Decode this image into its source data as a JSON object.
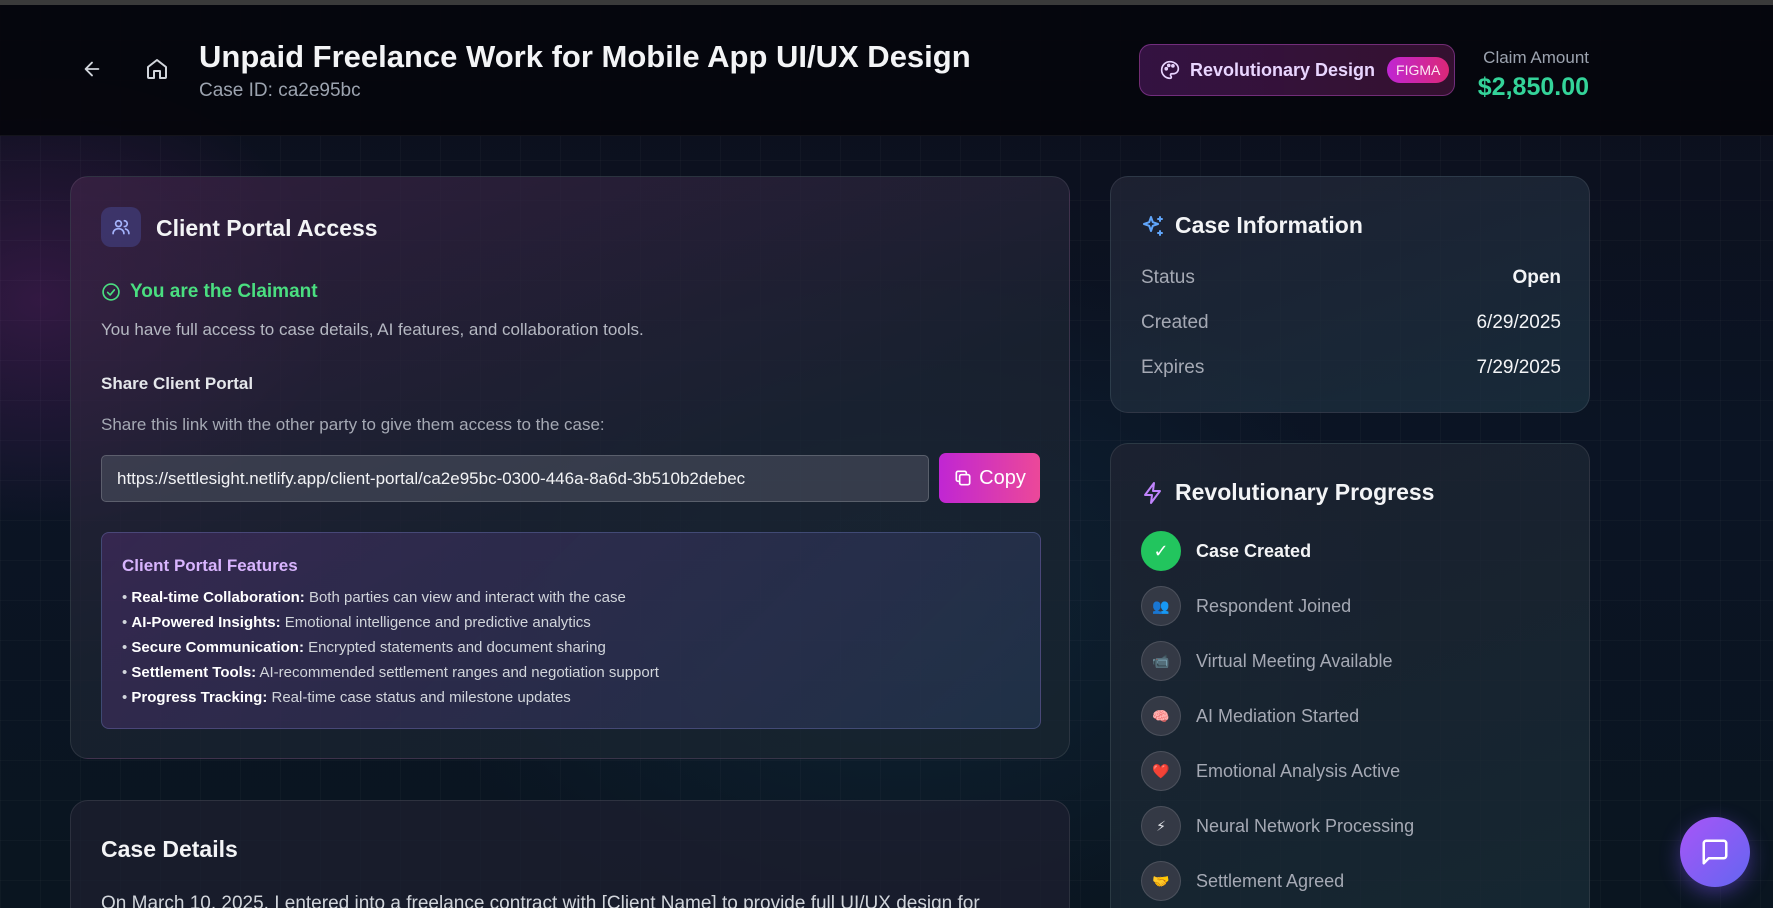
{
  "header": {
    "title": "Unpaid Freelance Work for Mobile App UI/UX Design",
    "case_id": "Case ID: ca2e95bc",
    "design_label": "Revolutionary Design",
    "design_tag": "FIGMA",
    "claim_label": "Claim Amount",
    "claim_amount": "$2,850.00"
  },
  "portal": {
    "title": "Client Portal Access",
    "claimant": "You are the Claimant",
    "access_text": "You have full access to case details, AI features, and collaboration tools.",
    "share_title": "Share Client Portal",
    "share_desc": "Share this link with the other party to give them access to the case:",
    "link": "https://settlesight.netlify.app/client-portal/ca2e95bc-0300-446a-8a6d-3b510b2debec",
    "copy_label": "Copy",
    "features_title": "Client Portal Features",
    "features": [
      {
        "name": "Real-time Collaboration:",
        "desc": "Both parties can view and interact with the case"
      },
      {
        "name": "AI-Powered Insights:",
        "desc": "Emotional intelligence and predictive analytics"
      },
      {
        "name": "Secure Communication:",
        "desc": "Encrypted statements and document sharing"
      },
      {
        "name": "Settlement Tools:",
        "desc": "AI-recommended settlement ranges and negotiation support"
      },
      {
        "name": "Progress Tracking:",
        "desc": "Real-time case status and milestone updates"
      }
    ]
  },
  "details": {
    "title": "Case Details",
    "text": "On March 10, 2025, I entered into a freelance contract with [Client Name] to provide full UI/UX design for"
  },
  "info": {
    "title": "Case Information",
    "rows": [
      {
        "key": "Status",
        "value": "Open"
      },
      {
        "key": "Created",
        "value": "6/29/2025"
      },
      {
        "key": "Expires",
        "value": "7/29/2025"
      }
    ]
  },
  "progress": {
    "title": "Revolutionary Progress",
    "steps": [
      {
        "label": "Case Created",
        "icon": "✓",
        "done": true
      },
      {
        "label": "Respondent Joined",
        "icon": "👥",
        "done": false
      },
      {
        "label": "Virtual Meeting Available",
        "icon": "📹",
        "done": false
      },
      {
        "label": "AI Mediation Started",
        "icon": "🧠",
        "done": false
      },
      {
        "label": "Emotional Analysis Active",
        "icon": "❤️",
        "done": false
      },
      {
        "label": "Neural Network Processing",
        "icon": "⚡",
        "done": false
      },
      {
        "label": "Settlement Agreed",
        "icon": "🤝",
        "done": false
      }
    ]
  },
  "colors": {
    "accent_green": "#34d399",
    "accent_pink": "#ec4899",
    "accent_purple": "#a855f7"
  }
}
